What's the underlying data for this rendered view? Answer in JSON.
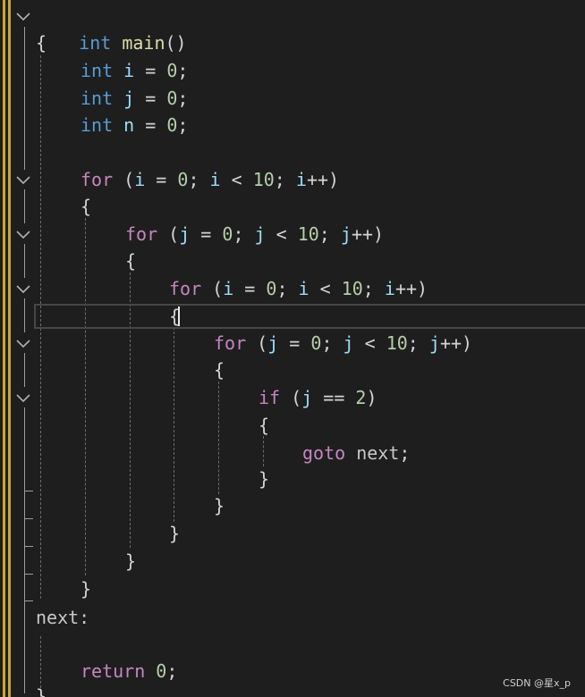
{
  "editor": {
    "lines": {
      "l0": {
        "kw": "int",
        "name": "main",
        "punc": "()"
      },
      "l1": {
        "text": "{"
      },
      "l2": {
        "kw": "int",
        "var": "i",
        "op": " = ",
        "num": "0",
        "end": ";"
      },
      "l3": {
        "kw": "int",
        "var": "j",
        "op": " = ",
        "num": "0",
        "end": ";"
      },
      "l4": {
        "kw": "int",
        "var": "n",
        "op": " = ",
        "num": "0",
        "end": ";"
      },
      "l6": {
        "kw": "for",
        "a": " (",
        "v1": "i",
        "b": " = ",
        "n1": "0",
        "c": "; ",
        "v2": "i",
        "d": " < ",
        "n2": "10",
        "e": "; ",
        "v3": "i",
        "f": "++)"
      },
      "l7": {
        "text": "{"
      },
      "l8": {
        "kw": "for",
        "a": " (",
        "v1": "j",
        "b": " = ",
        "n1": "0",
        "c": "; ",
        "v2": "j",
        "d": " < ",
        "n2": "10",
        "e": "; ",
        "v3": "j",
        "f": "++)"
      },
      "l9": {
        "text": "{"
      },
      "l10": {
        "kw": "for",
        "a": " (",
        "v1": "i",
        "b": " = ",
        "n1": "0",
        "c": "; ",
        "v2": "i",
        "d": " < ",
        "n2": "10",
        "e": "; ",
        "v3": "i",
        "f": "++)"
      },
      "l11": {
        "text": "{"
      },
      "l12": {
        "kw": "for",
        "a": " (",
        "v1": "j",
        "b": " = ",
        "n1": "0",
        "c": "; ",
        "v2": "j",
        "d": " < ",
        "n2": "10",
        "e": "; ",
        "v3": "j",
        "f": "++)"
      },
      "l13": {
        "text": "{"
      },
      "l14": {
        "kw": "if",
        "a": " (",
        "v1": "j",
        "b": " == ",
        "n1": "2",
        "c": ")"
      },
      "l15": {
        "text": "{"
      },
      "l16": {
        "kw": "goto",
        "label": " next",
        "end": ";"
      },
      "l17": {
        "text": "}"
      },
      "l18": {
        "text": "}"
      },
      "l19": {
        "text": "}"
      },
      "l20": {
        "text": "}"
      },
      "l21": {
        "text": "}"
      },
      "l22": {
        "text": "next:"
      },
      "l24": {
        "kw": "return",
        "sp": " ",
        "num": "0",
        "end": ";"
      },
      "l25": {
        "text": "}"
      }
    }
  },
  "watermark": "CSDN @星x_p",
  "colors": {
    "background": "#1e1e1e",
    "keyword_type": "#569cd6",
    "keyword_control": "#c586c0",
    "function": "#dcdcaa",
    "variable": "#9cdcfe",
    "number": "#b5cea8",
    "gutter_marker": "#e5c07b"
  }
}
